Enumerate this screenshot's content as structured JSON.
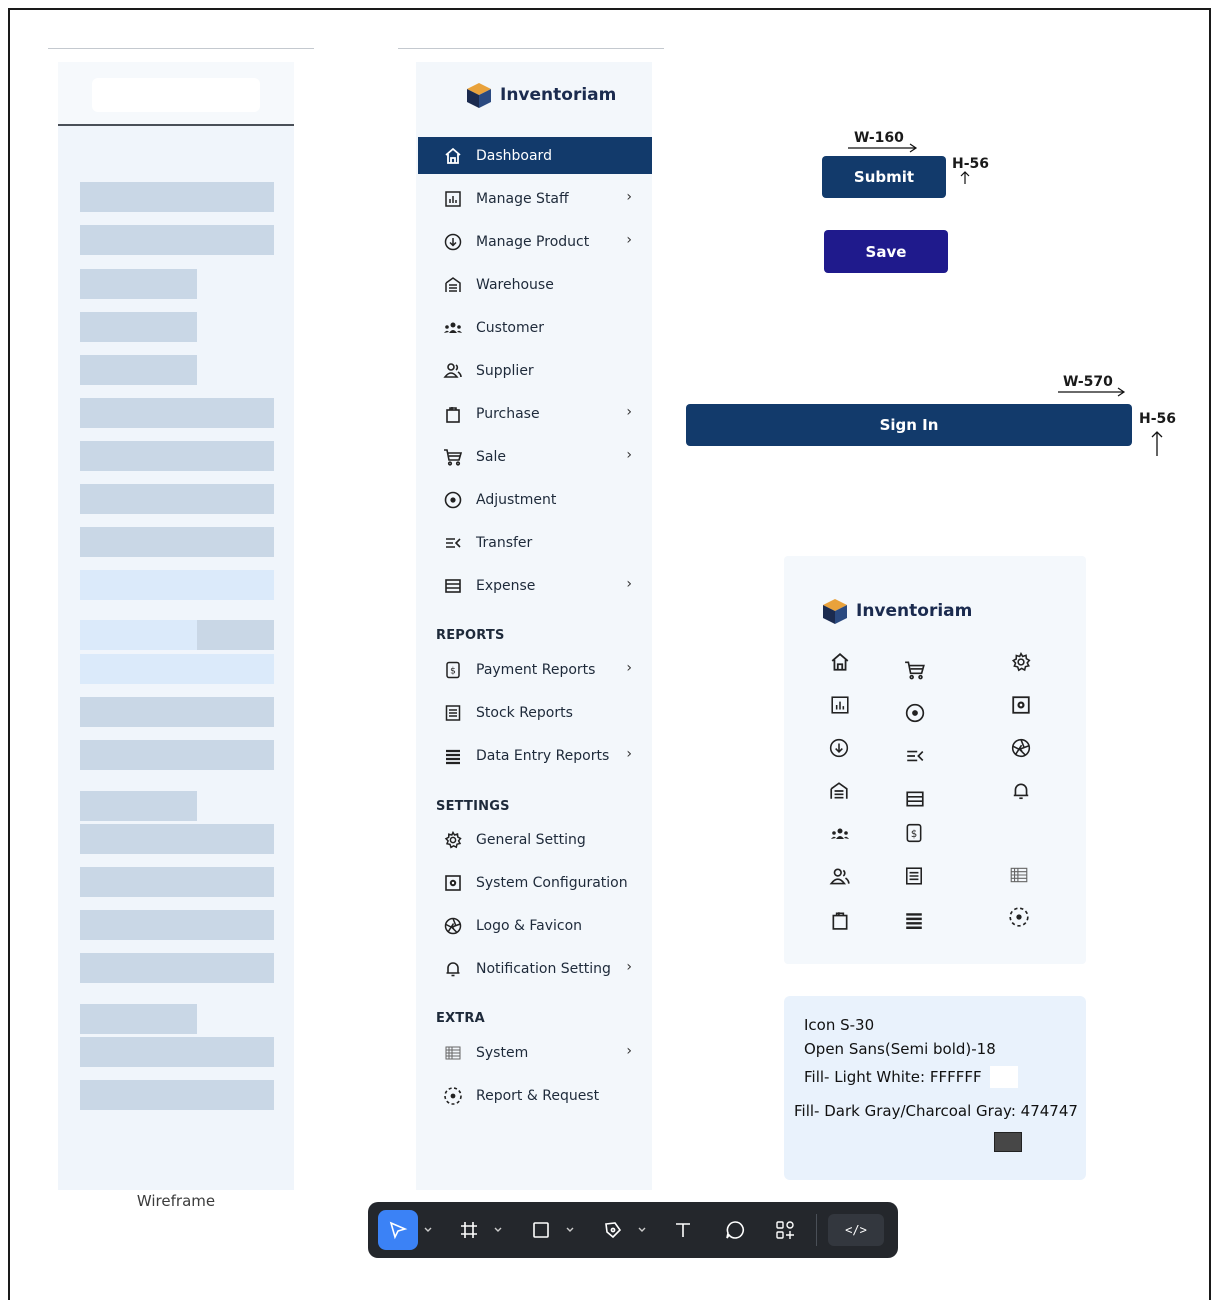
{
  "wireframe": {
    "label": "Wireframe"
  },
  "sidebar": {
    "brand": "Inventoriam",
    "items": [
      {
        "label": "Dashboard",
        "icon": "home-icon",
        "chevron": false,
        "active": true
      },
      {
        "label": "Manage Staff",
        "icon": "chart-icon",
        "chevron": true
      },
      {
        "label": "Manage Product",
        "icon": "download-circle-icon",
        "chevron": true
      },
      {
        "label": "Warehouse",
        "icon": "warehouse-icon",
        "chevron": false
      },
      {
        "label": "Customer",
        "icon": "users-group-icon",
        "chevron": false
      },
      {
        "label": "Supplier",
        "icon": "user-pair-icon",
        "chevron": false
      },
      {
        "label": "Purchase",
        "icon": "shopping-bag-icon",
        "chevron": true
      },
      {
        "label": "Sale",
        "icon": "cart-icon",
        "chevron": true
      },
      {
        "label": "Adjustment",
        "icon": "target-icon",
        "chevron": false
      },
      {
        "label": "Transfer",
        "icon": "transfer-icon",
        "chevron": false
      },
      {
        "label": "Expense",
        "icon": "list-icon",
        "chevron": true
      }
    ],
    "sections": [
      {
        "title": "REPORTS",
        "items": [
          {
            "label": "Payment Reports",
            "icon": "receipt-icon",
            "chevron": true
          },
          {
            "label": "Stock Reports",
            "icon": "document-list-icon",
            "chevron": false
          },
          {
            "label": "Data Entry Reports",
            "icon": "lines-icon",
            "chevron": true
          }
        ]
      },
      {
        "title": "SETTINGS",
        "items": [
          {
            "label": "General Setting",
            "icon": "gear-icon",
            "chevron": false
          },
          {
            "label": "System Configuration",
            "icon": "config-icon",
            "chevron": false
          },
          {
            "label": "Logo & Favicon",
            "icon": "aperture-icon",
            "chevron": false
          },
          {
            "label": "Notification Setting",
            "icon": "bell-icon",
            "chevron": true
          }
        ]
      },
      {
        "title": "EXTRA",
        "items": [
          {
            "label": "System",
            "icon": "grid-icon",
            "chevron": true
          },
          {
            "label": "Report & Request",
            "icon": "dashed-circle-icon",
            "chevron": false
          }
        ]
      }
    ]
  },
  "buttons": {
    "submit": {
      "label": "Submit",
      "width_label": "W-160",
      "height_label": "H-56",
      "color": "#123a6b"
    },
    "save": {
      "label": "Save",
      "color": "#1f1a8c"
    },
    "signin": {
      "label": "Sign In",
      "width_label": "W-570",
      "height_label": "H-56",
      "color": "#123a6b"
    }
  },
  "icon_sheet": {
    "brand": "Inventoriam"
  },
  "spec": {
    "line1": "Icon S-30",
    "line2": "Open Sans(Semi bold)-18",
    "line3": "Fill- Light White: FFFFFF",
    "line4": "Fill- Dark Gray/Charcoal Gray: 474747",
    "light_color": "#FFFFFF",
    "dark_color": "#474747"
  },
  "toolbar": {
    "code_label": "</>"
  }
}
